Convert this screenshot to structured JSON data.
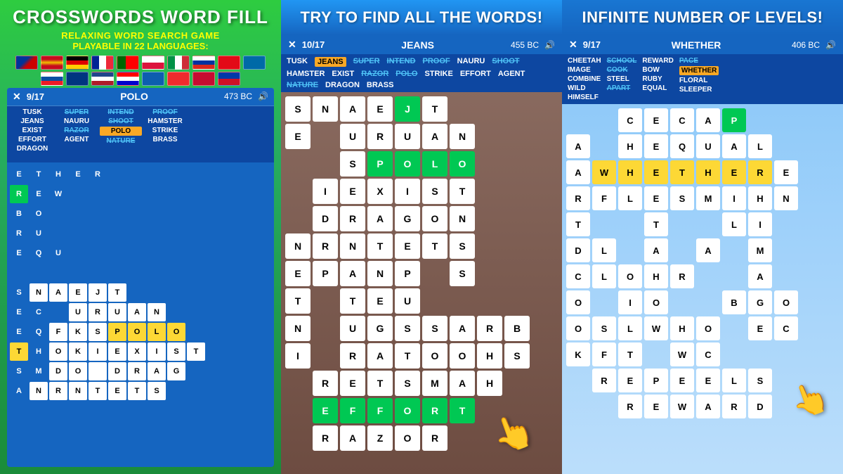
{
  "panel1": {
    "title": "CROSSWORDS WORD FILL",
    "subtitle": "RELAXING WORD SEARCH GAME",
    "subtitle2": "PLAYABLE IN 22 LANGUAGES:",
    "game": {
      "progress": "9/17",
      "word": "POLO",
      "score": "473 BC",
      "words": [
        {
          "text": "TUSK",
          "state": "normal"
        },
        {
          "text": "JEANS",
          "state": "normal"
        },
        {
          "text": "EXIST",
          "state": "normal"
        },
        {
          "text": "EFFORT",
          "state": "normal"
        },
        {
          "text": "DRAGON",
          "state": "normal"
        },
        {
          "text": "SUPER",
          "state": "found"
        },
        {
          "text": "NAURU",
          "state": "normal"
        },
        {
          "text": "RAZOR",
          "state": "found"
        },
        {
          "text": "AGENT",
          "state": "normal"
        },
        {
          "text": "INTEND",
          "state": "found"
        },
        {
          "text": "SHOOT",
          "state": "found"
        },
        {
          "text": "POLO",
          "state": "active"
        },
        {
          "text": "NATURE",
          "state": "found"
        },
        {
          "text": "PROOF",
          "state": "found"
        },
        {
          "text": "HAMSTER",
          "state": "normal"
        },
        {
          "text": "STRIKE",
          "state": "normal"
        },
        {
          "text": "BRASS",
          "state": "normal"
        }
      ]
    }
  },
  "panel2": {
    "title": "TRY TO FIND ALL THE WORDS!",
    "game": {
      "progress": "10/17",
      "word": "JEANS",
      "score": "455 BC",
      "words": [
        {
          "text": "TUSK",
          "state": "normal"
        },
        {
          "text": "JEANS",
          "state": "active"
        },
        {
          "text": "EXIST",
          "state": "normal"
        },
        {
          "text": "EFFORT",
          "state": "normal"
        },
        {
          "text": "DRAGON",
          "state": "normal"
        },
        {
          "text": "SUPER",
          "state": "found"
        },
        {
          "text": "NAURU",
          "state": "normal"
        },
        {
          "text": "RAZOR",
          "state": "found"
        },
        {
          "text": "AGENT",
          "state": "normal"
        },
        {
          "text": "INTEND",
          "state": "found"
        },
        {
          "text": "SHOOT",
          "state": "found"
        },
        {
          "text": "POLO",
          "state": "found"
        },
        {
          "text": "NATURE",
          "state": "found"
        },
        {
          "text": "PROOF",
          "state": "found"
        },
        {
          "text": "HAMSTER",
          "state": "normal"
        },
        {
          "text": "STRIKE",
          "state": "normal"
        },
        {
          "text": "BRASS",
          "state": "normal"
        }
      ],
      "grid": [
        [
          "S",
          "N",
          "A",
          "E",
          "J",
          "T",
          ""
        ],
        [
          "",
          "E",
          "",
          "",
          "U",
          "R",
          "U",
          "A",
          "N"
        ],
        [
          "",
          "",
          "",
          "S",
          "P",
          "O",
          "L",
          "O",
          ""
        ],
        [
          "",
          "",
          "",
          "I",
          "E",
          "X",
          "I",
          "S",
          "T"
        ],
        [
          "",
          "D",
          "R",
          "A",
          "G",
          "O",
          "N",
          "",
          ""
        ],
        [
          "N",
          "R",
          "N",
          "T",
          "E",
          "T",
          "S",
          "",
          ""
        ],
        [
          "E",
          "P",
          "A",
          "N",
          "P",
          "",
          "S",
          "",
          ""
        ],
        [
          "",
          "T",
          "",
          "T",
          "E",
          "U",
          "",
          "",
          ""
        ],
        [
          "",
          "N",
          "",
          "U",
          "G",
          "S",
          "S",
          "A",
          "R",
          "B"
        ],
        [
          "",
          "I",
          "",
          "R",
          "A",
          "T",
          "O",
          "O",
          "H",
          "S"
        ],
        [
          "",
          "",
          "R",
          "E",
          "T",
          "S",
          "M",
          "A",
          "H",
          ""
        ],
        [
          "",
          "",
          "",
          "",
          "E",
          "F",
          "F",
          "O",
          "R",
          "T"
        ],
        [
          "",
          "",
          "",
          "",
          "R",
          "A",
          "Z",
          "O",
          "R",
          ""
        ]
      ]
    }
  },
  "panel3": {
    "title": "INFINITE NUMBER OF LEVELS!",
    "game": {
      "progress": "9/17",
      "word": "WHETHER",
      "score": "406 BC",
      "words": [
        {
          "text": "CHEETAH",
          "state": "normal"
        },
        {
          "text": "IMAGE",
          "state": "normal"
        },
        {
          "text": "COMBINE",
          "state": "normal"
        },
        {
          "text": "WILD",
          "state": "normal"
        },
        {
          "text": "HIMSELF",
          "state": "normal"
        },
        {
          "text": "SCHOOL",
          "state": "found"
        },
        {
          "text": "COOK",
          "state": "found"
        },
        {
          "text": "STEEL",
          "state": "normal"
        },
        {
          "text": "APART",
          "state": "found"
        },
        {
          "text": "REWARD",
          "state": "normal"
        },
        {
          "text": "BOW",
          "state": "normal"
        },
        {
          "text": "RUBY",
          "state": "normal"
        },
        {
          "text": "EQUAL",
          "state": "normal"
        },
        {
          "text": "PACE",
          "state": "found"
        },
        {
          "text": "WHETHER",
          "state": "active"
        },
        {
          "text": "FLORAL",
          "state": "normal"
        },
        {
          "text": "SLEEPER",
          "state": "normal"
        }
      ],
      "grid": [
        [
          "",
          "",
          "C",
          "E",
          "C",
          "A",
          "P"
        ],
        [
          "A",
          "",
          "H",
          "E",
          "Q",
          "U",
          "A",
          "L"
        ],
        [
          "A",
          "W",
          "H",
          "E",
          "T",
          "H",
          "E",
          "R",
          "E"
        ],
        [
          "R",
          "F",
          "L",
          "E",
          "S",
          "M",
          "I",
          "H",
          "N"
        ],
        [
          "T",
          "",
          "",
          "T",
          "",
          "",
          "L",
          "I",
          ""
        ],
        [
          "D",
          "L",
          "",
          "A",
          "",
          "A",
          "",
          "M",
          ""
        ],
        [
          "C",
          "L",
          "O",
          "H",
          "R",
          "",
          "",
          "A",
          ""
        ],
        [
          "O",
          "",
          "I",
          "O",
          "",
          "",
          "B",
          "G",
          "O"
        ],
        [
          "O",
          "S",
          "L",
          "W",
          "H",
          "O",
          "",
          "E",
          "C"
        ],
        [
          "K",
          "F",
          "T",
          "",
          "W",
          "C",
          "",
          "",
          ""
        ],
        [
          "",
          "R",
          "E",
          "P",
          "E",
          "E",
          "L",
          "S",
          ""
        ],
        [
          "",
          "",
          "R",
          "E",
          "W",
          "A",
          "R",
          "D",
          ""
        ]
      ]
    }
  }
}
